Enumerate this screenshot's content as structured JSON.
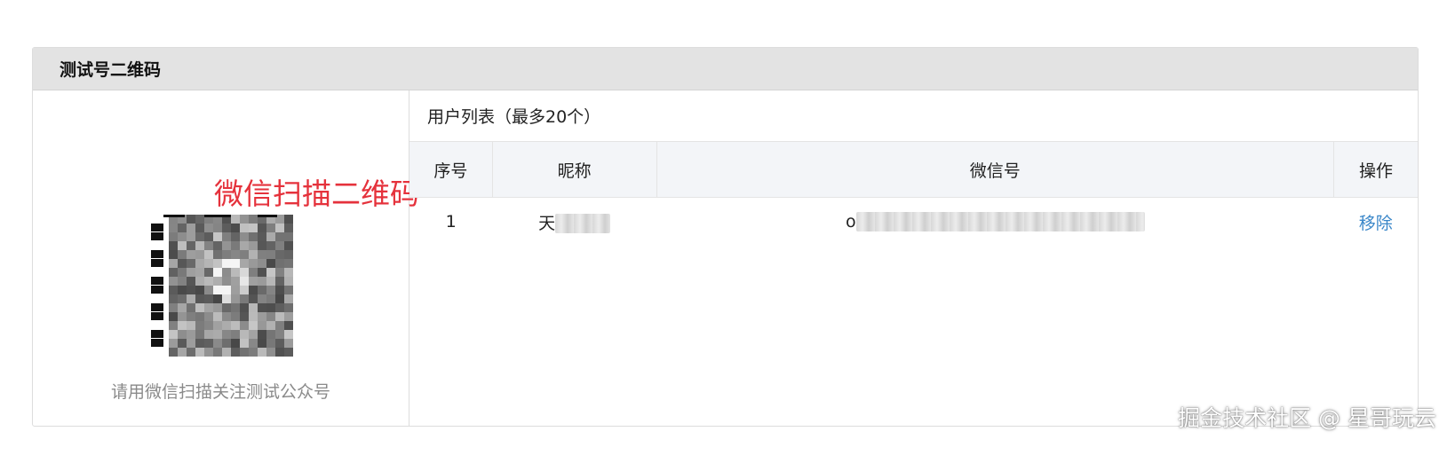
{
  "panel": {
    "title": "测试号二维码"
  },
  "qr": {
    "annotation": "微信扫描二维码",
    "caption": "请用微信扫描关注测试公众号",
    "annotation_color": "#e5323c"
  },
  "user_list": {
    "title": "用户列表（最多20个）",
    "columns": [
      "序号",
      "昵称",
      "微信号",
      "操作"
    ],
    "rows": [
      {
        "index": "1",
        "nickname": "天",
        "wechat_id": "o",
        "action": "移除"
      }
    ]
  },
  "watermark": "掘金技术社区 @ 星哥玩云",
  "colors": {
    "link": "#3a87c9",
    "header_bg": "#e3e3e3",
    "table_head_bg": "#f3f5f8"
  }
}
